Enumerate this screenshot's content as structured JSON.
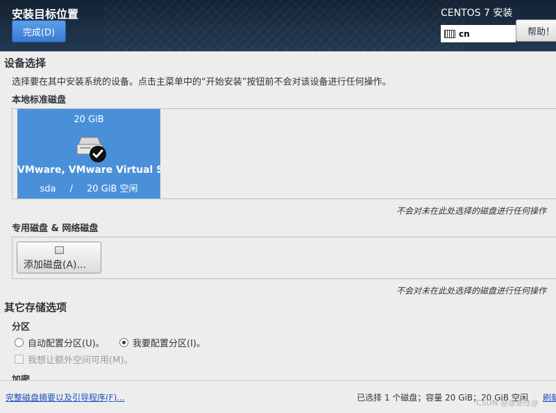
{
  "header": {
    "spoke_title": "安装目标位置",
    "done_label": "完成(D)",
    "product_title": "CENTOS 7 安装",
    "keyboard_layout": "cn",
    "help_label": "帮助！"
  },
  "device_selection": {
    "title": "设备选择",
    "description": "选择要在其中安装系统的设备。点击主菜单中的“开始安装”按钮前不会对该设备进行任何操作。",
    "local_disks_title": "本地标准磁盘",
    "disk": {
      "size": "20 GiB",
      "name": "VMware, VMware Virtual S",
      "device": "sda",
      "separator": "/",
      "free": "20 GiB 空闲",
      "selected": true
    },
    "local_note": "不会对未在此处选择的磁盘进行任何操作",
    "specialized_title": "专用磁盘 & 网络磁盘",
    "add_disk_label": "添加磁盘(A)...",
    "specialized_note": "不会对未在此处选择的磁盘进行任何操作"
  },
  "other_options": {
    "title": "其它存储选项",
    "partitioning_title": "分区",
    "auto_partition_label": "自动配置分区(U)。",
    "manual_partition_label": "我要配置分区(I)。",
    "selected_partitioning": "manual",
    "extra_space_label": "我想让额外空间可用(M)。",
    "encryption_title": "加密"
  },
  "footer": {
    "summary_link": "完整磁盘摘要以及引导程序(F)...",
    "status": "已选择 1 个磁盘；容量 20 GiB；20 GiB 空闲",
    "refresh_link": "刷新",
    "watermark": "CSDN @@逆往@"
  },
  "colors": {
    "header_bg": "#1c2f45",
    "accent_blue": "#4a90d9",
    "link_blue": "#1c4ec0",
    "background": "#ededed"
  }
}
